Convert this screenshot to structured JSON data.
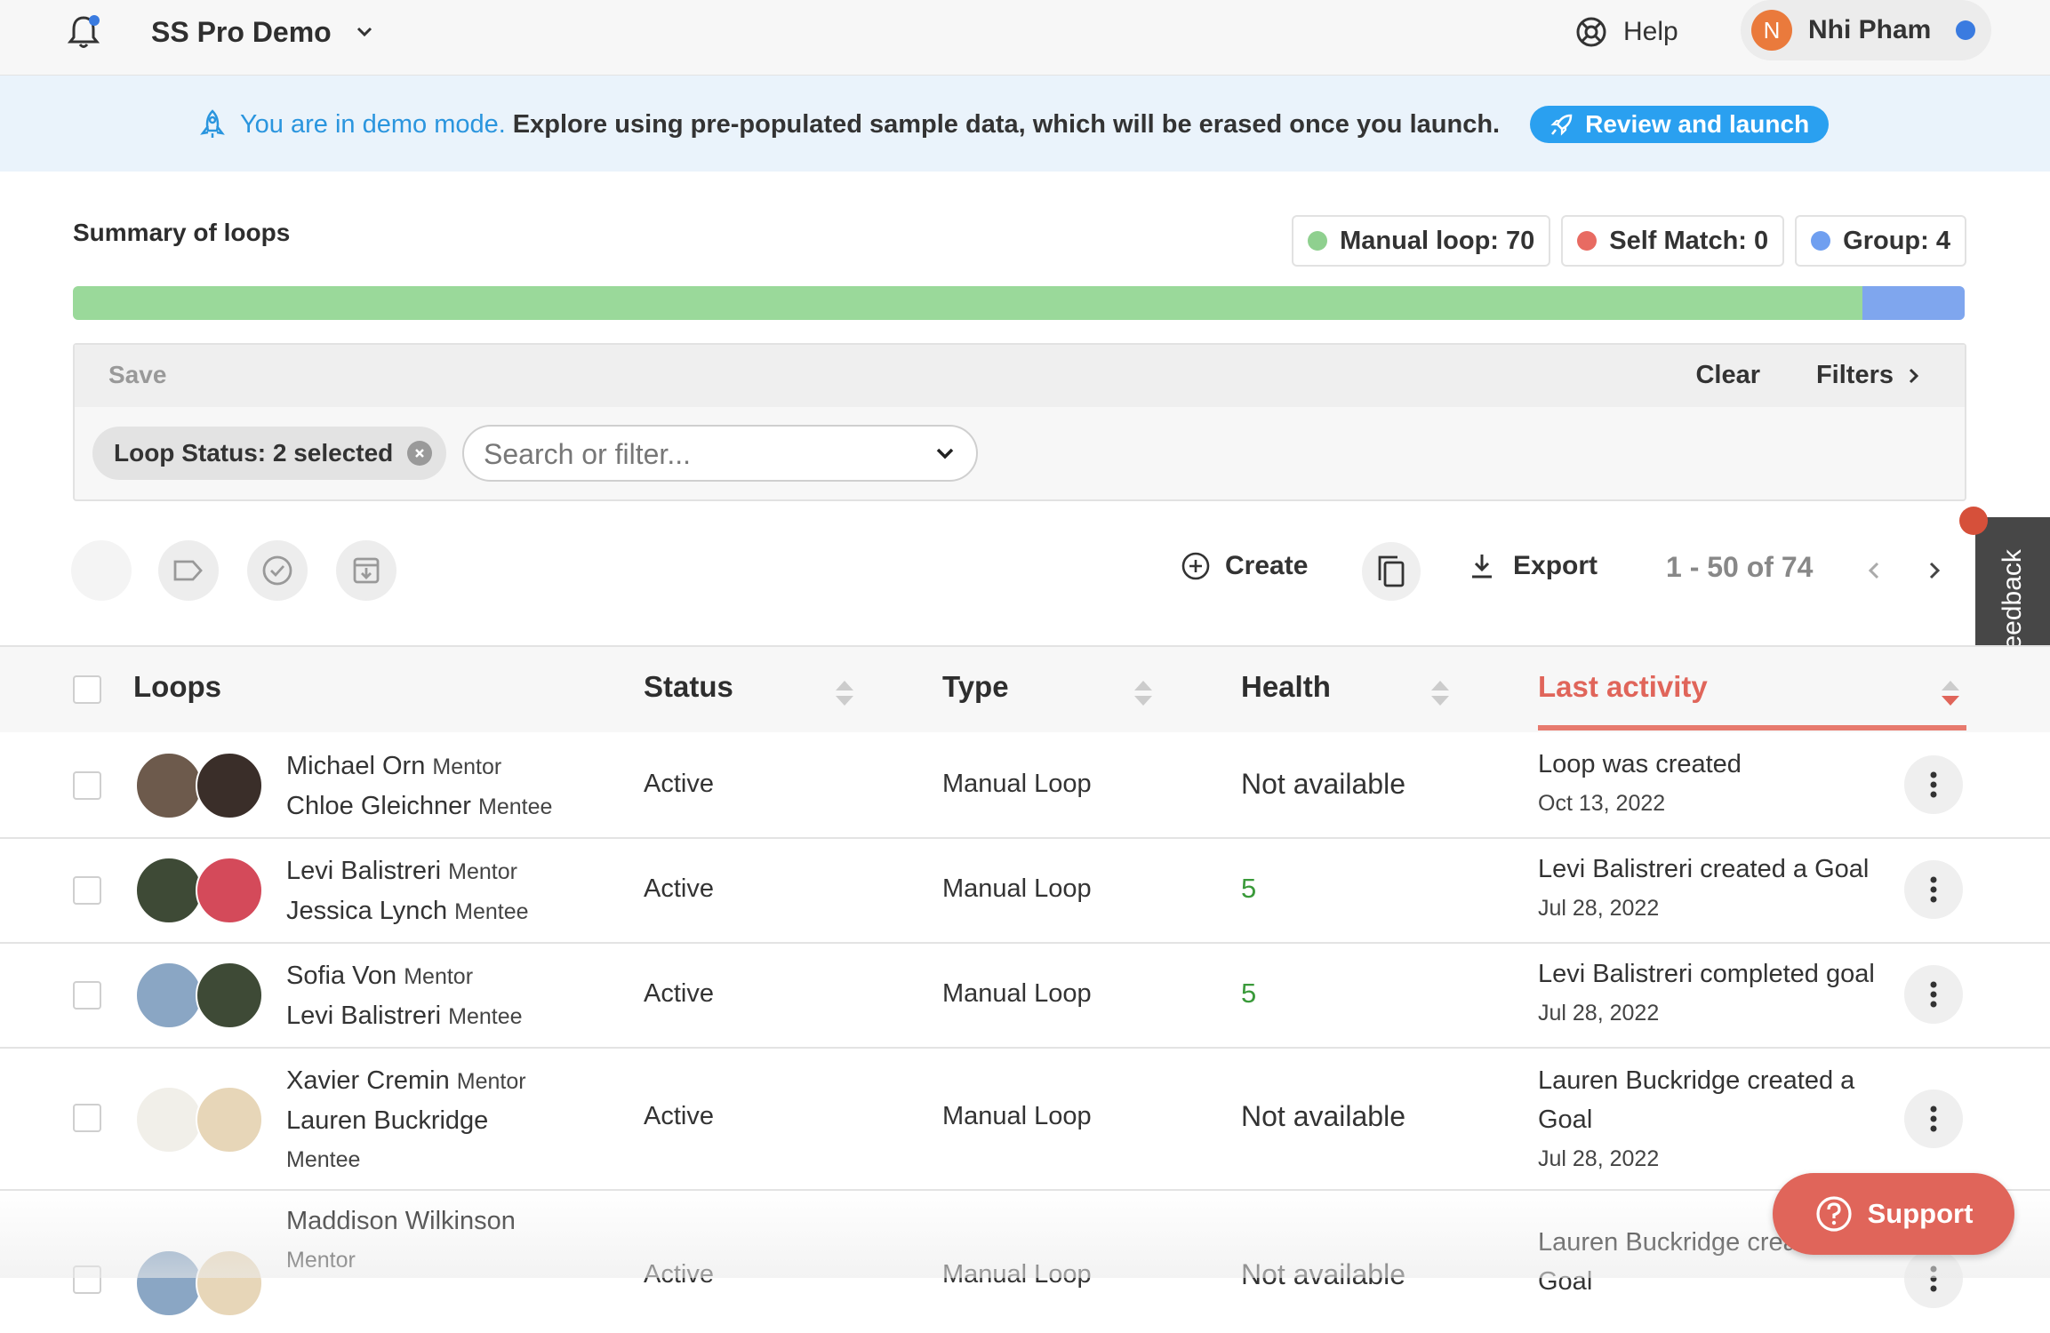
{
  "header": {
    "org_name": "SS Pro Demo",
    "help_label": "Help",
    "user_initial": "N",
    "user_name": "Nhi Pham"
  },
  "banner": {
    "highlight": "You are in demo mode.",
    "text": "Explore using pre-populated sample data, which will be erased once you launch.",
    "button": "Review and launch"
  },
  "summary": {
    "title": "Summary of loops",
    "chips": [
      {
        "label": "Manual loop: 70",
        "color": "#8fd08f"
      },
      {
        "label": "Self Match: 0",
        "color": "#e86b62"
      },
      {
        "label": "Group: 4",
        "color": "#6f9ff0"
      }
    ],
    "bar": [
      {
        "name": "Manual loop",
        "value": 70,
        "color": "#9ad99a"
      },
      {
        "name": "Self Match",
        "value": 0,
        "color": "#e86b62"
      },
      {
        "name": "Group",
        "value": 4,
        "color": "#7fa6ee"
      }
    ]
  },
  "filters": {
    "save_label": "Save",
    "clear_label": "Clear",
    "filters_label": "Filters",
    "status_tag": "Loop Status: 2 selected",
    "search_placeholder": "Search or filter..."
  },
  "toolbar": {
    "create_label": "Create",
    "export_label": "Export",
    "pagination": "1 - 50 of 74"
  },
  "feedback_label": "Feedback",
  "table": {
    "columns": [
      "Loops",
      "Status",
      "Type",
      "Health",
      "Last activity"
    ],
    "rows": [
      {
        "mentor": "Michael Orn",
        "mentor_role": "Mentor",
        "mentee": "Chloe Gleichner",
        "mentee_role": "Mentee",
        "status": "Active",
        "type": "Manual Loop",
        "health": "Not available",
        "activity": "Loop was created",
        "date": "Oct 13, 2022"
      },
      {
        "mentor": "Levi Balistreri",
        "mentor_role": "Mentor",
        "mentee": "Jessica Lynch",
        "mentee_role": "Mentee",
        "status": "Active",
        "type": "Manual Loop",
        "health": "5",
        "activity": "Levi Balistreri created a Goal",
        "date": "Jul 28, 2022"
      },
      {
        "mentor": "Sofia Von",
        "mentor_role": "Mentor",
        "mentee": "Levi Balistreri",
        "mentee_role": "Mentee",
        "status": "Active",
        "type": "Manual Loop",
        "health": "5",
        "activity": "Levi Balistreri completed goal",
        "date": "Jul 28, 2022"
      },
      {
        "mentor": "Xavier Cremin",
        "mentor_role": "Mentor",
        "mentee": "Lauren Buckridge",
        "mentee_role": "Mentee",
        "status": "Active",
        "type": "Manual Loop",
        "health": "Not available",
        "activity": "Lauren Buckridge created a Goal",
        "date": "Jul 28, 2022"
      },
      {
        "mentor": "Maddison Wilkinson",
        "mentor_role": "Mentor",
        "status": "Active",
        "type": "Manual Loop",
        "health": "Not available",
        "activity": "Lauren Buckridge created a Goal"
      }
    ]
  },
  "support_label": "Support"
}
